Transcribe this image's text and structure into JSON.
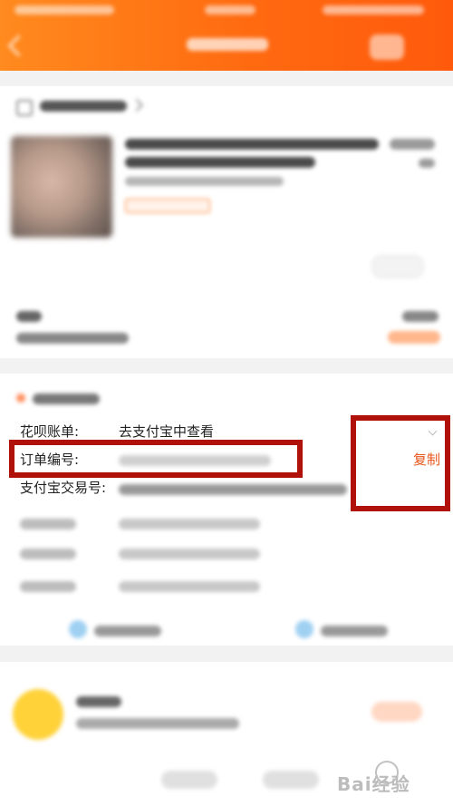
{
  "order_info": {
    "huabei_label": "花呗账单:",
    "huabei_value": "去支付宝中查看",
    "order_no_label": "订单编号:",
    "alipay_trade_label": "支付宝交易号:",
    "copy_button": "复制"
  },
  "watermark": {
    "text": "Bai经验"
  },
  "colors": {
    "header_orange": "#ff6a10",
    "copy_link": "#e8551a",
    "highlight_red": "#b0120a"
  }
}
